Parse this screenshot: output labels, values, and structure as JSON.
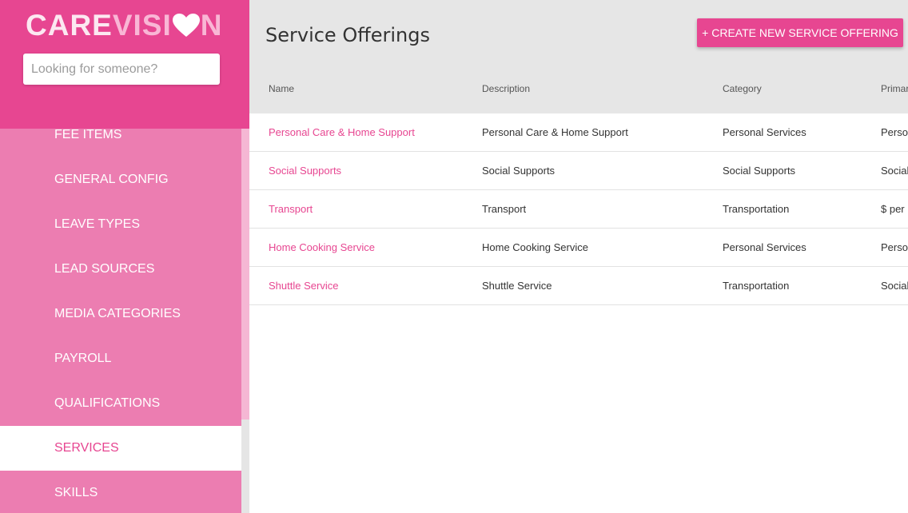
{
  "app": {
    "logo_part1": "CARE",
    "logo_part2": "VISI",
    "logo_part3": "N"
  },
  "search": {
    "placeholder": "Looking for someone?"
  },
  "sidebar": {
    "items": [
      {
        "label": "FEE ITEMS",
        "active": false
      },
      {
        "label": "GENERAL CONFIG",
        "active": false
      },
      {
        "label": "LEAVE TYPES",
        "active": false
      },
      {
        "label": "LEAD SOURCES",
        "active": false
      },
      {
        "label": "MEDIA CATEGORIES",
        "active": false
      },
      {
        "label": "PAYROLL",
        "active": false
      },
      {
        "label": "QUALIFICATIONS",
        "active": false
      },
      {
        "label": "SERVICES",
        "active": true
      },
      {
        "label": "SKILLS",
        "active": false
      }
    ]
  },
  "main": {
    "title": "Service Offerings",
    "create_label": "+ CREATE NEW SERVICE OFFERING",
    "columns": [
      "Name",
      "Description",
      "Category",
      "Primar"
    ],
    "rows": [
      {
        "name": "Personal Care & Home Support",
        "description": "Personal Care & Home Support",
        "category": "Personal Services",
        "primary": "Perso"
      },
      {
        "name": "Social Supports",
        "description": "Social Supports",
        "category": "Social Supports",
        "primary": "Social"
      },
      {
        "name": "Transport",
        "description": "Transport",
        "category": "Transportation",
        "primary": "$ per"
      },
      {
        "name": "Home Cooking Service",
        "description": "Home Cooking Service",
        "category": "Personal Services",
        "primary": "Perso"
      },
      {
        "name": "Shuttle Service",
        "description": "Shuttle Service",
        "category": "Transportation",
        "primary": "Social"
      }
    ]
  },
  "colors": {
    "brand": "#e74691",
    "sidebar": "#ec7db1",
    "header_bg": "#e6e6e6"
  }
}
